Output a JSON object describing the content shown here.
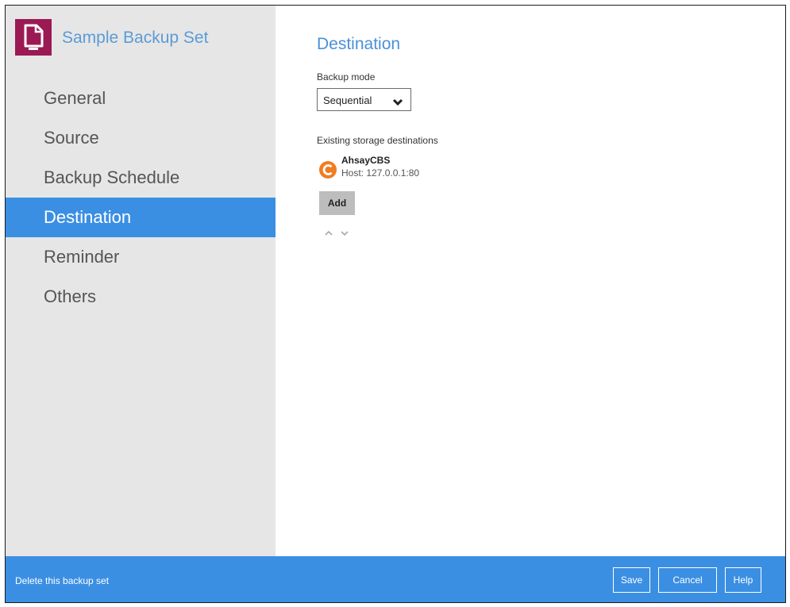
{
  "sidebar": {
    "title": "Sample Backup Set",
    "icon": "file-icon",
    "items": [
      {
        "label": "General",
        "active": false
      },
      {
        "label": "Source",
        "active": false
      },
      {
        "label": "Backup Schedule",
        "active": false
      },
      {
        "label": "Destination",
        "active": true
      },
      {
        "label": "Reminder",
        "active": false
      },
      {
        "label": "Others",
        "active": false
      }
    ]
  },
  "main": {
    "title": "Destination",
    "backup_mode_label": "Backup mode",
    "backup_mode_value": "Sequential",
    "existing_label": "Existing storage destinations",
    "destinations": [
      {
        "name": "AhsayCBS",
        "host": "Host: 127.0.0.1:80",
        "icon": "ahsay-cbs-logo-icon"
      }
    ],
    "add_label": "Add"
  },
  "footer": {
    "delete_label": "Delete this backup set",
    "save_label": "Save",
    "cancel_label": "Cancel",
    "help_label": "Help"
  },
  "colors": {
    "accent": "#3b8fe3",
    "title_blue": "#4a90d9",
    "sidebar_bg": "#e6e6e6",
    "set_icon_bg": "#9b1a54",
    "cbs_orange": "#f07d22"
  }
}
